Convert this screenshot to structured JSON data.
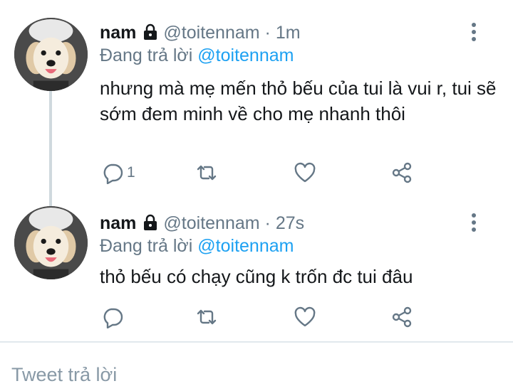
{
  "tweets": [
    {
      "name": "nam",
      "handle": "@toitennam",
      "separator": "·",
      "time": "1m",
      "replying_prefix": "Đang trả lời",
      "replying_handle": "@toitennam",
      "text": "nhưng mà mẹ mến thỏ bếu của tui là vui r, tui sẽ sớm đem minh về cho mẹ nhanh thôi",
      "reply_count": "1"
    },
    {
      "name": "nam",
      "handle": "@toitennam",
      "separator": "·",
      "time": "27s",
      "replying_prefix": "Đang trả lời",
      "replying_handle": "@toitennam",
      "text": "thỏ bếu có chạy cũng k trốn đc tui đâu",
      "reply_count": ""
    }
  ],
  "compose": {
    "placeholder": "Tweet trả lời"
  },
  "colors": {
    "accent": "#1da1f2",
    "secondary_text": "#657786",
    "primary_text": "#14171a",
    "thread_line": "#cfd9de"
  },
  "icons": [
    "lock-icon",
    "more-vert-icon",
    "reply-icon",
    "retweet-icon",
    "like-icon",
    "share-icon"
  ]
}
